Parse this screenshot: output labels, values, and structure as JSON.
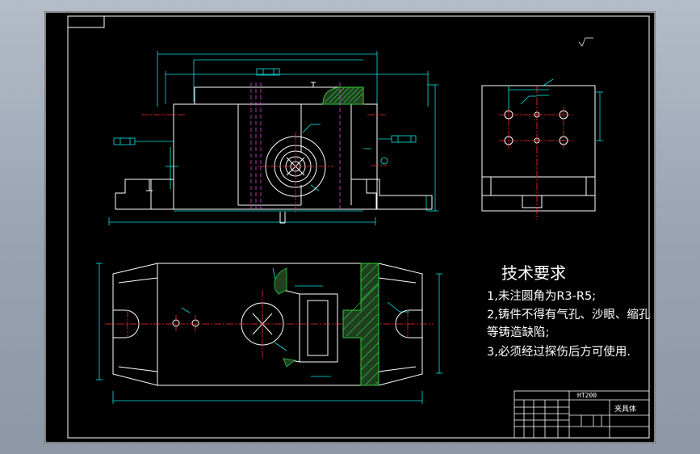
{
  "colors": {
    "background": "#000000",
    "outline": "#ffffff",
    "dimension": "#00e5e5",
    "centerline": "#ff2a2a",
    "hidden_line": "#e040e0",
    "hatch": "#2ecc40",
    "section_fill": "#1f3f1f"
  },
  "technical_requirements": {
    "title": "技术要求",
    "notes": [
      "1,未注圆角为R3-R5;",
      "2,铸件不得有气孔、沙眼、缩孔",
      "等铸造缺陷;",
      "3,必须经过探伤后方可使用."
    ]
  },
  "title_block": {
    "material": "HT200",
    "part_name": "夹具体"
  }
}
